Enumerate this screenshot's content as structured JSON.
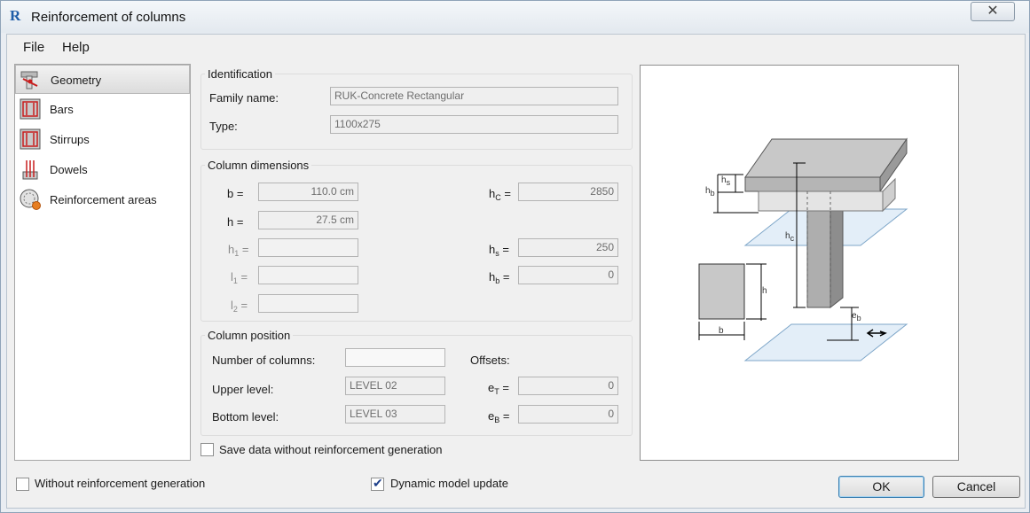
{
  "window": {
    "title": "Reinforcement of columns",
    "app_icon_letter": "R",
    "close_glyph": "✕"
  },
  "menu": {
    "file": "File",
    "help": "Help"
  },
  "nav": {
    "items": [
      {
        "label": "Geometry",
        "icon": "geometry-icon"
      },
      {
        "label": "Bars",
        "icon": "bars-icon"
      },
      {
        "label": "Stirrups",
        "icon": "stirrups-icon"
      },
      {
        "label": "Dowels",
        "icon": "dowels-icon"
      },
      {
        "label": "Reinforcement areas",
        "icon": "reinforcement-areas-icon"
      }
    ]
  },
  "identification": {
    "title": "Identification",
    "family_label": "Family name:",
    "family_value": "RUK-Concrete Rectangular",
    "type_label": "Type:",
    "type_value": "1100x275"
  },
  "dimensions": {
    "title": "Column dimensions",
    "b_label": "b =",
    "b_value": "110.0 cm",
    "h_label": "h =",
    "h_value": "27.5 cm",
    "h1_label": "h",
    "h1_sub": "1",
    "h1_eq": " =",
    "h1_value": "",
    "l1_label": "l",
    "l1_sub": "1",
    "l1_eq": " =",
    "l1_value": "",
    "l2_label": "l",
    "l2_sub": "2",
    "l2_eq": " =",
    "l2_value": "",
    "hc_label": "h",
    "hc_sub": "C",
    "hc_eq": " =",
    "hc_value": "2850",
    "hs_label": "h",
    "hs_sub": "s",
    "hs_eq": " =",
    "hs_value": "250",
    "hb_label": "h",
    "hb_sub": "b",
    "hb_eq": " =",
    "hb_value": "0"
  },
  "position": {
    "title": "Column position",
    "num_label": "Number of columns:",
    "num_value": "",
    "upper_label": "Upper level:",
    "upper_value": "LEVEL 02",
    "bottom_label": "Bottom level:",
    "bottom_value": "LEVEL 03",
    "offsets_label": "Offsets:",
    "et_label": "e",
    "et_sub": "T",
    "et_eq": " =",
    "et_value": "0",
    "eb_label": "e",
    "eb_sub": "B",
    "eb_eq": " =",
    "eb_value": "0"
  },
  "diagram": {
    "hs": "h",
    "hs_sub": "s",
    "hb": "h",
    "hb_sub": "b",
    "hc": "h",
    "hc_sub": "c",
    "h": "h",
    "b": "b",
    "eb": "e",
    "eb_sub": "b"
  },
  "options": {
    "save_without": "Save data without reinforcement generation",
    "save_without_checked": false,
    "without_generation": "Without reinforcement generation",
    "without_generation_checked": false,
    "dynamic_update": "Dynamic model update",
    "dynamic_update_checked": true
  },
  "buttons": {
    "ok": "OK",
    "cancel": "Cancel"
  }
}
